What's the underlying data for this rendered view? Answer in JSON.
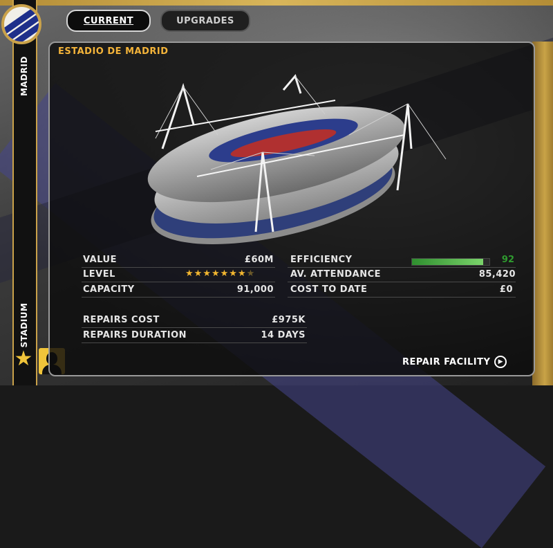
{
  "tabs": {
    "current_label": "CURRENT",
    "upgrades_label": "UPGRADES"
  },
  "rail": {
    "top_label": "MADRID",
    "bottom_label": "STADIUM"
  },
  "panel": {
    "title": "ESTADIO DE MADRID"
  },
  "stats": {
    "value_label": "VALUE",
    "value_value": "£60M",
    "level_label": "LEVEL",
    "level_rating": 7,
    "level_max": 8,
    "capacity_label": "CAPACITY",
    "capacity_value": "91,000",
    "efficiency_label": "EFFICIENCY",
    "efficiency_value": "92",
    "efficiency_fraction": 0.92,
    "attendance_label": "AV. ATTENDANCE",
    "attendance_value": "85,420",
    "cost_label": "COST TO DATE",
    "cost_value": "£0",
    "repairs_cost_label": "REPAIRS COST",
    "repairs_cost_value": "£975K",
    "repairs_duration_label": "REPAIRS DURATION",
    "repairs_duration_value": "14 DAYS"
  },
  "actions": {
    "repair_label": "REPAIR FACILITY"
  },
  "colors": {
    "accent_gold": "#caa24a",
    "title_orange": "#f4b43a",
    "efficiency_green": "#2f9b2f"
  },
  "icons": {
    "crest": "club-crest-icon",
    "star": "star-icon",
    "avatar": "manager-avatar-icon",
    "play": "play-circle-icon"
  }
}
